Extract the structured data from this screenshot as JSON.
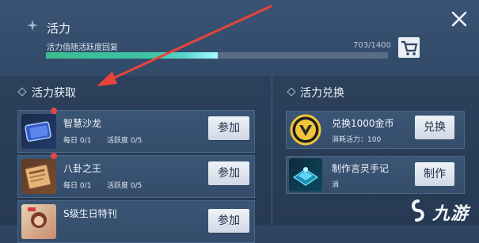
{
  "header": {
    "title": "活力",
    "subtitle": "活力值随活跃度回复",
    "vitality_value": "703/1400",
    "vitality_fraction": 0.5021,
    "shop_icon": "shopping-cart-icon",
    "close_icon": "close-icon"
  },
  "acquire": {
    "section_title": "活力获取",
    "tasks": [
      {
        "name": "智慧沙龙",
        "daily": "每日 0/1",
        "activity": "活跃度 0/5",
        "button": "参加",
        "icon": "salon-ticket-icon",
        "has_badge": true
      },
      {
        "name": "八卦之王",
        "daily": "每日 0/1",
        "activity": "活跃度 0/5",
        "button": "参加",
        "icon": "gossip-newspaper-icon",
        "has_badge": true
      },
      {
        "name": "S级生日特刊",
        "button": "参加",
        "icon": "birthday-magazine-icon",
        "has_badge": false
      }
    ]
  },
  "exchange": {
    "section_title": "活力兑换",
    "items": [
      {
        "name": "兑换1000金币",
        "cost": "消耗活力：100",
        "button": "兑换",
        "icon": "gold-coin-icon"
      },
      {
        "name": "制作言灵手记",
        "cost": "消",
        "button": "制作",
        "icon": "spirit-notebook-icon"
      }
    ]
  },
  "watermark": {
    "text": "九游",
    "icon": "jiuyou-logo-icon"
  },
  "colors": {
    "progress_start": "#3bbd8f",
    "progress_end": "#6fe6f0",
    "arrow": "#e8443a",
    "badge": "#e54646"
  }
}
